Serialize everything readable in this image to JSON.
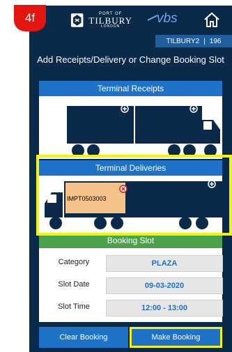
{
  "step_badge": "4f",
  "header": {
    "logo_port": "PORT OF",
    "logo_tilbury": "TILBURY",
    "logo_london": "LONDON",
    "vbs_logo": "vbs"
  },
  "user_bar": {
    "terminal": "TILBURY2",
    "number": "196"
  },
  "page_title": "Add Receipts/Delivery or Change Booking Slot",
  "receipts": {
    "title": "Terminal Receipts"
  },
  "deliveries": {
    "title": "Terminal Deliveries",
    "container_ref": "IMPT0503003"
  },
  "booking": {
    "title": "Booking Slot",
    "category_label": "Category",
    "category_value": "PLAZA",
    "date_label": "Slot Date",
    "date_value": "09-03-2020",
    "time_label": "Slot Time",
    "time_value": "12:00 - 13:00"
  },
  "buttons": {
    "clear": "Clear Booking",
    "make": "Make Booking"
  },
  "colors": {
    "navy": "#0b2a4a",
    "blue": "#1e73c8",
    "green": "#4aa24a",
    "highlight": "#f6f20c",
    "badge": "#e3160f",
    "container_slot": "#f6c48a"
  }
}
